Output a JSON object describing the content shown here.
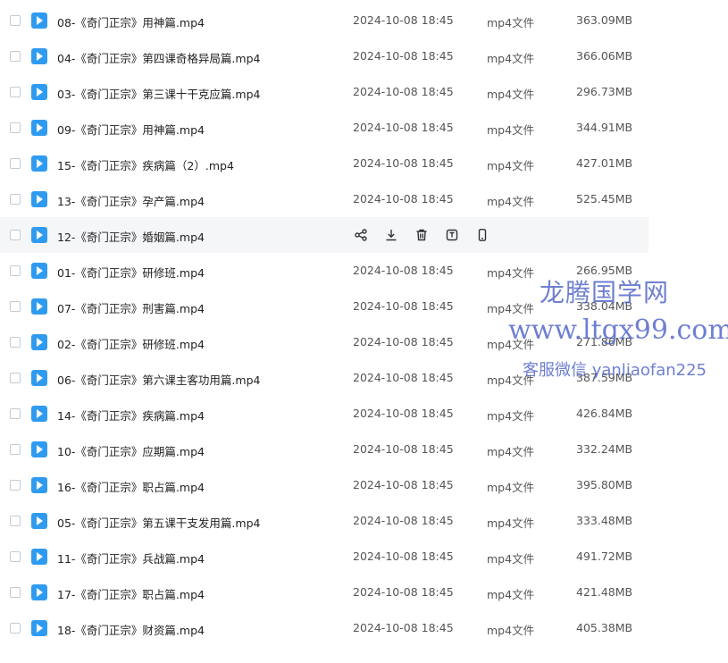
{
  "files": [
    {
      "name": "08-《奇门正宗》用神篇.mp4",
      "date": "2024-10-08 18:45",
      "type": "mp4文件",
      "size": "363.09MB"
    },
    {
      "name": "04-《奇门正宗》第四课奇格异局篇.mp4",
      "date": "2024-10-08 18:45",
      "type": "mp4文件",
      "size": "366.06MB"
    },
    {
      "name": "03-《奇门正宗》第三课十干克应篇.mp4",
      "date": "2024-10-08 18:45",
      "type": "mp4文件",
      "size": "296.73MB"
    },
    {
      "name": "09-《奇门正宗》用神篇.mp4",
      "date": "2024-10-08 18:45",
      "type": "mp4文件",
      "size": "344.91MB"
    },
    {
      "name": "15-《奇门正宗》疾病篇（2）.mp4",
      "date": "2024-10-08 18:45",
      "type": "mp4文件",
      "size": "427.01MB"
    },
    {
      "name": "13-《奇门正宗》孕产篇.mp4",
      "date": "2024-10-08 18:45",
      "type": "mp4文件",
      "size": "525.45MB"
    },
    {
      "name": "12-《奇门正宗》婚姻篇.mp4",
      "hovered": true
    },
    {
      "name": "01-《奇门正宗》研修班.mp4",
      "date": "2024-10-08 18:45",
      "type": "mp4文件",
      "size": "266.95MB"
    },
    {
      "name": "07-《奇门正宗》刑害篇.mp4",
      "date": "2024-10-08 18:45",
      "type": "mp4文件",
      "size": "338.04MB"
    },
    {
      "name": "02-《奇门正宗》研修班.mp4",
      "date": "2024-10-08 18:45",
      "type": "mp4文件",
      "size": "271.86MB"
    },
    {
      "name": "06-《奇门正宗》第六课主客功用篇.mp4",
      "date": "2024-10-08 18:45",
      "type": "mp4文件",
      "size": "387.59MB"
    },
    {
      "name": "14-《奇门正宗》疾病篇.mp4",
      "date": "2024-10-08 18:45",
      "type": "mp4文件",
      "size": "426.84MB"
    },
    {
      "name": "10-《奇门正宗》应期篇.mp4",
      "date": "2024-10-08 18:45",
      "type": "mp4文件",
      "size": "332.24MB"
    },
    {
      "name": "16-《奇门正宗》职占篇.mp4",
      "date": "2024-10-08 18:45",
      "type": "mp4文件",
      "size": "395.80MB"
    },
    {
      "name": "05-《奇门正宗》第五课干支发用篇.mp4",
      "date": "2024-10-08 18:45",
      "type": "mp4文件",
      "size": "333.48MB"
    },
    {
      "name": "11-《奇门正宗》兵战篇.mp4",
      "date": "2024-10-08 18:45",
      "type": "mp4文件",
      "size": "491.72MB"
    },
    {
      "name": "17-《奇门正宗》职占篇.mp4",
      "date": "2024-10-08 18:45",
      "type": "mp4文件",
      "size": "421.48MB"
    },
    {
      "name": "18-《奇门正宗》财资篇.mp4",
      "date": "2024-10-08 18:45",
      "type": "mp4文件",
      "size": "405.38MB"
    }
  ],
  "hover_actions": [
    "share-icon",
    "download-icon",
    "delete-icon",
    "rename-icon",
    "phone-icon"
  ],
  "watermark": {
    "line1": "龙腾国学网",
    "line2": "www.ltgx99.com",
    "line3": "客服微信 yanliaofan225"
  },
  "colors": {
    "file_icon": "#2f9bf0",
    "watermark": "#4f63c7",
    "hover_row": "#f5f6f8"
  }
}
